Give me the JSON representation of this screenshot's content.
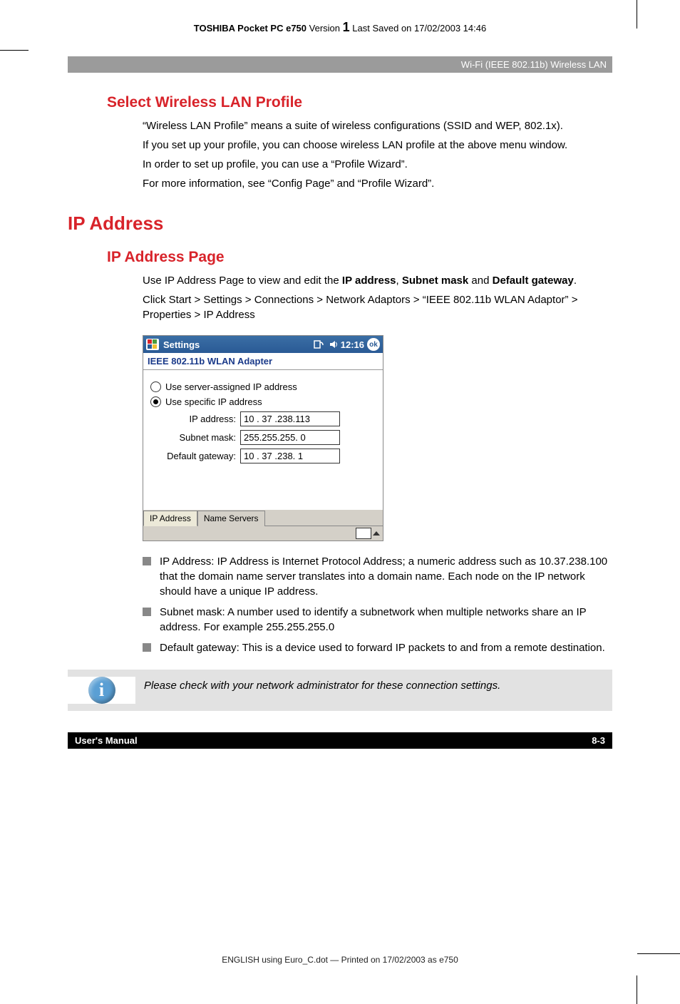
{
  "doc_header": {
    "product_bold": "TOSHIBA Pocket PC e750",
    "version_label": "Version",
    "version_num": "1",
    "saved": "Last Saved on 17/02/2003 14:46"
  },
  "chapter_bar": "Wi-Fi (IEEE 802.11b) Wireless LAN",
  "section1": {
    "heading": "Select Wireless LAN Profile",
    "p1": "“Wireless LAN Profile” means a suite of wireless configurations (SSID and WEP, 802.1x).",
    "p2": "If you set up your profile, you can choose wireless LAN profile at the above menu window.",
    "p3": "In order to set up profile, you can use a “Profile Wizard”.",
    "p4": "For more information, see “Config Page” and “Profile Wizard”."
  },
  "h1": "IP Address",
  "section2": {
    "heading": "IP Address Page",
    "p1_pre": "Use IP Address Page to view and edit the ",
    "p1_b1": "IP address",
    "p1_mid1": ", ",
    "p1_b2": "Subnet mask",
    "p1_mid2": " and ",
    "p1_b3": "Default gateway",
    "p1_post": ".",
    "p2": "Click Start > Settings > Connections > Network Adaptors > “IEEE 802.11b WLAN Adaptor” > Properties > IP Address"
  },
  "screenshot": {
    "titlebar": {
      "title": "Settings",
      "time": "12:16",
      "ok": "ok"
    },
    "subtitle": "IEEE 802.11b WLAN Adapter",
    "radio1": "Use server-assigned IP address",
    "radio2": "Use specific IP address",
    "fields": {
      "ip_label": "IP address:",
      "ip_value": "10 . 37 .238.113",
      "mask_label": "Subnet mask:",
      "mask_value": "255.255.255.  0",
      "gw_label": "Default gateway:",
      "gw_value": "10 . 37 .238.  1"
    },
    "tabs": {
      "t1": "IP Address",
      "t2": "Name Servers"
    }
  },
  "bullets": [
    {
      "label": "IP Address:",
      "text": " IP Address is Internet Protocol Address; a numeric address such as 10.37.238.100 that the domain name server translates into a domain name. Each node on the IP network should have a unique IP address."
    },
    {
      "label": "Subnet mask:",
      "text": " A number used to identify a subnetwork when multiple networks share an IP address. For example 255.255.255.0"
    },
    {
      "label": "Default gateway:",
      "text": " This is a device used to forward IP packets to and from a remote destination."
    }
  ],
  "note": "Please check with your network administrator for these connection settings.",
  "footer": {
    "left": "User's Manual",
    "right": "8-3"
  },
  "print_line": "ENGLISH using Euro_C.dot — Printed on 17/02/2003 as e750"
}
